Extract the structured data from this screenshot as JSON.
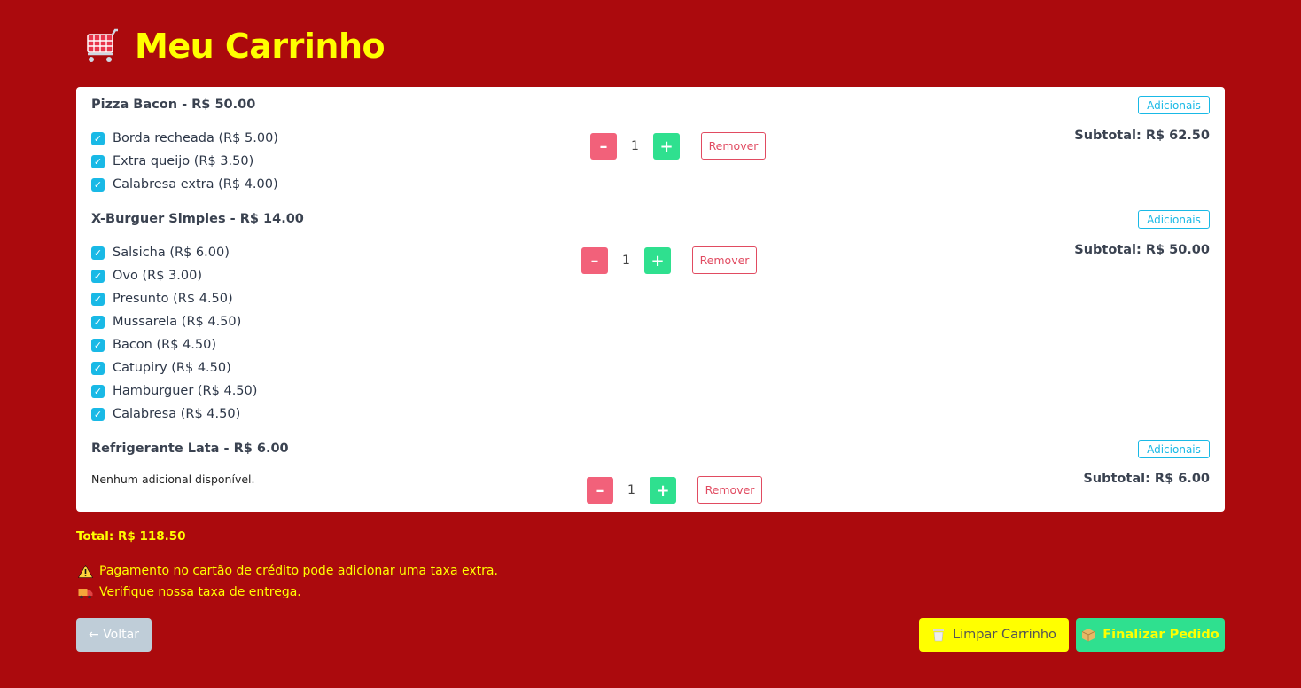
{
  "header": {
    "title": "Meu Carrinho",
    "icon": "shopping-cart-icon"
  },
  "items": [
    {
      "name": "Pizza Bacon - R$ 50.00",
      "add_label": "Adicionais",
      "extras": [
        "Borda recheada (R$ 5.00)",
        "Extra queijo (R$ 3.50)",
        "Calabresa extra (R$ 4.00)"
      ],
      "quantity": "1",
      "remove_label": "Remover",
      "subtotal": "Subtotal: R$ 62.50"
    },
    {
      "name": "X-Burguer Simples - R$ 14.00",
      "add_label": "Adicionais",
      "extras": [
        "Salsicha (R$ 6.00)",
        "Ovo (R$ 3.00)",
        "Presunto (R$ 4.50)",
        "Mussarela (R$ 4.50)",
        "Bacon (R$ 4.50)",
        "Catupiry (R$ 4.50)",
        "Hamburguer (R$ 4.50)",
        "Calabresa (R$ 4.50)"
      ],
      "quantity": "1",
      "remove_label": "Remover",
      "subtotal": "Subtotal: R$ 50.00"
    },
    {
      "name": "Refrigerante Lata - R$ 6.00",
      "add_label": "Adicionais",
      "no_extras": "Nenhum adicional disponível.",
      "quantity": "1",
      "remove_label": "Remover",
      "subtotal": "Subtotal: R$ 6.00"
    }
  ],
  "total": "Total: R$ 118.50",
  "notices": [
    {
      "icon": "warning-icon",
      "text": "Pagamento no cartão de crédito pode adicionar uma taxa extra."
    },
    {
      "icon": "truck-icon",
      "text": "Verifique nossa taxa de entrega."
    }
  ],
  "actions": {
    "back_label": "← Voltar",
    "clear_label": "Limpar Carrinho",
    "finish_label": "Finalizar Pedido"
  },
  "colors": {
    "background": "#ab0a0d",
    "accent_yellow": "#ffff00",
    "info_blue": "#19b9e6",
    "danger": "#f2617a",
    "success": "#2fe08f"
  }
}
